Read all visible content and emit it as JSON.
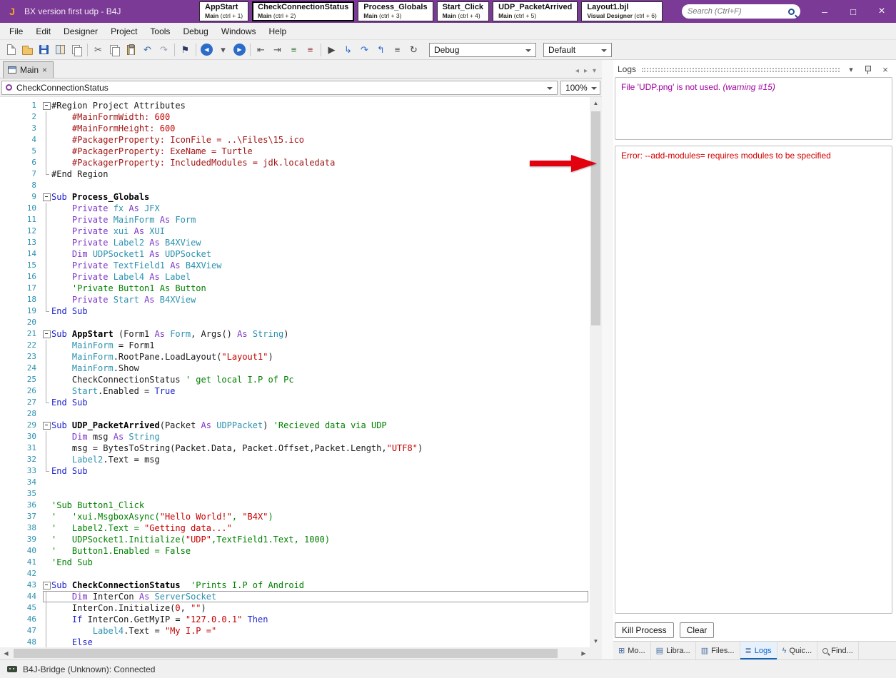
{
  "colors": {
    "titlebar": "#7A3A95",
    "warning_text": "#A000A0",
    "error_text": "#D40000",
    "line_number": "#2B91AF",
    "keyword": "#2025CC",
    "declaration": "#7C36C8",
    "type": "#2B91AF",
    "comment": "#008000",
    "string": "#C80000",
    "arrow": "#E3000F"
  },
  "titlebar": {
    "title": "BX version first udp - B4J",
    "search_placeholder": "Search (Ctrl+F)",
    "quick_tabs": [
      {
        "title": "AppStart",
        "sub_strong": "Main",
        "sub_rest": "  (ctrl + 1)",
        "selected": false
      },
      {
        "title": "CheckConnectionStatus",
        "sub_strong": "Main",
        "sub_rest": "  (ctrl + 2)",
        "selected": true
      },
      {
        "title": "Process_Globals",
        "sub_strong": "Main",
        "sub_rest": "  (ctrl + 3)",
        "selected": false
      },
      {
        "title": "Start_Click",
        "sub_strong": "Main",
        "sub_rest": "  (ctrl + 4)",
        "selected": false
      },
      {
        "title": "UDP_PacketArrived",
        "sub_strong": "Main",
        "sub_rest": "  (ctrl + 5)",
        "selected": false
      },
      {
        "title": "Layout1.bjl",
        "sub_strong": "Visual Designer",
        "sub_rest": "  (ctrl + 6)",
        "selected": false
      }
    ]
  },
  "menubar": {
    "items": [
      "File",
      "Edit",
      "Designer",
      "Project",
      "Tools",
      "Debug",
      "Windows",
      "Help"
    ]
  },
  "toolbar": {
    "debug_mode": "Debug",
    "build_configuration": "Default",
    "icons": [
      {
        "name": "new-icon",
        "kind": "page"
      },
      {
        "name": "open-icon",
        "kind": "folder"
      },
      {
        "name": "save-icon",
        "kind": "floppy"
      },
      {
        "name": "modules-icon",
        "kind": "grid"
      },
      {
        "name": "export-icon",
        "kind": "pages"
      },
      {
        "name": "sep1",
        "kind": "sep"
      },
      {
        "name": "cut-icon",
        "kind": "glyph",
        "glyph": "✂",
        "color": "#555555"
      },
      {
        "name": "copy-icon",
        "kind": "pages"
      },
      {
        "name": "paste-icon",
        "kind": "clip"
      },
      {
        "name": "undo-icon",
        "kind": "glyph",
        "glyph": "↶",
        "color": "#3A6EA5"
      },
      {
        "name": "redo-icon",
        "kind": "glyph",
        "glyph": "↷",
        "color": "#9AA7B8"
      },
      {
        "name": "sep2",
        "kind": "sep"
      },
      {
        "name": "bookmark-icon",
        "kind": "glyph",
        "glyph": "⚑",
        "color": "#2B3A67"
      },
      {
        "name": "sep3",
        "kind": "sep"
      },
      {
        "name": "navigate-back-icon",
        "kind": "navback"
      },
      {
        "name": "back-history-icon",
        "kind": "glyph",
        "glyph": "▾",
        "color": "#555555"
      },
      {
        "name": "navigate-forward-icon",
        "kind": "navfwd"
      },
      {
        "name": "sep4",
        "kind": "sep"
      },
      {
        "name": "outdent-icon",
        "kind": "glyph",
        "glyph": "⇤",
        "color": "#555555"
      },
      {
        "name": "indent-icon",
        "kind": "glyph",
        "glyph": "⇥",
        "color": "#555555"
      },
      {
        "name": "comment-icon",
        "kind": "glyph",
        "glyph": "≡",
        "color": "#3F7F3F"
      },
      {
        "name": "uncomment-icon",
        "kind": "glyph",
        "glyph": "≡",
        "color": "#9A3F3F"
      },
      {
        "name": "sep5",
        "kind": "sep"
      },
      {
        "name": "run-icon",
        "kind": "glyph",
        "glyph": "▶",
        "color": "#444444"
      },
      {
        "name": "step-into-icon",
        "kind": "glyph",
        "glyph": "↳",
        "color": "#2F6FD0"
      },
      {
        "name": "step-over-icon",
        "kind": "glyph",
        "glyph": "↷",
        "color": "#2F6FD0"
      },
      {
        "name": "step-out-icon",
        "kind": "glyph",
        "glyph": "↰",
        "color": "#2F6FD0"
      },
      {
        "name": "pause-icon",
        "kind": "glyph",
        "glyph": "≡",
        "color": "#555555"
      },
      {
        "name": "restart-icon",
        "kind": "glyph",
        "glyph": "↻",
        "color": "#444444"
      }
    ]
  },
  "editor": {
    "tab_label": "Main",
    "current_sub": "CheckConnectionStatus",
    "zoom": "100%",
    "lines": [
      {
        "n": 1,
        "f": "s",
        "s": [
          [
            "#Region Project Attributes",
            "pln"
          ]
        ]
      },
      {
        "n": 2,
        "f": "m",
        "s": [
          [
            "    ",
            "pln"
          ],
          [
            "#MainFormWidth: ",
            "dir"
          ],
          [
            "600",
            "num"
          ]
        ]
      },
      {
        "n": 3,
        "f": "m",
        "s": [
          [
            "    ",
            "pln"
          ],
          [
            "#MainFormHeight: ",
            "dir"
          ],
          [
            "600",
            "num"
          ]
        ]
      },
      {
        "n": 4,
        "f": "m",
        "s": [
          [
            "    ",
            "pln"
          ],
          [
            "#PackagerProperty: ",
            "dir"
          ],
          [
            "IconFile = ..\\Files\\15.ico",
            "dir"
          ]
        ]
      },
      {
        "n": 5,
        "f": "m",
        "s": [
          [
            "    ",
            "pln"
          ],
          [
            "#PackagerProperty: ",
            "dir"
          ],
          [
            "ExeName = Turtle",
            "dir"
          ]
        ]
      },
      {
        "n": 6,
        "f": "m",
        "s": [
          [
            "    ",
            "pln"
          ],
          [
            "#PackagerProperty: ",
            "dir"
          ],
          [
            "IncludedModules = jdk.localedata",
            "dir"
          ]
        ]
      },
      {
        "n": 7,
        "f": "e",
        "s": [
          [
            "#End Region",
            "pln"
          ]
        ]
      },
      {
        "n": 8,
        "f": "",
        "s": []
      },
      {
        "n": 9,
        "f": "s",
        "s": [
          [
            "Sub ",
            "kw"
          ],
          [
            "Process_Globals",
            "sub"
          ]
        ]
      },
      {
        "n": 10,
        "f": "m",
        "s": [
          [
            "    ",
            "pln"
          ],
          [
            "Private ",
            "decl"
          ],
          [
            "fx ",
            "var"
          ],
          [
            "As ",
            "decl"
          ],
          [
            "JFX",
            "type"
          ]
        ]
      },
      {
        "n": 11,
        "f": "m",
        "s": [
          [
            "    ",
            "pln"
          ],
          [
            "Private ",
            "decl"
          ],
          [
            "MainForm ",
            "var"
          ],
          [
            "As ",
            "decl"
          ],
          [
            "Form",
            "type"
          ]
        ]
      },
      {
        "n": 12,
        "f": "m",
        "s": [
          [
            "    ",
            "pln"
          ],
          [
            "Private ",
            "decl"
          ],
          [
            "xui ",
            "var"
          ],
          [
            "As ",
            "decl"
          ],
          [
            "XUI",
            "type"
          ]
        ]
      },
      {
        "n": 13,
        "f": "m",
        "s": [
          [
            "    ",
            "pln"
          ],
          [
            "Private ",
            "decl"
          ],
          [
            "Label2 ",
            "var"
          ],
          [
            "As ",
            "decl"
          ],
          [
            "B4XView",
            "type"
          ]
        ]
      },
      {
        "n": 14,
        "f": "m",
        "s": [
          [
            "    ",
            "pln"
          ],
          [
            "Dim ",
            "decl"
          ],
          [
            "UDPSocket1 ",
            "var"
          ],
          [
            "As ",
            "decl"
          ],
          [
            "UDPSocket",
            "type"
          ]
        ]
      },
      {
        "n": 15,
        "f": "m",
        "s": [
          [
            "    ",
            "pln"
          ],
          [
            "Private ",
            "decl"
          ],
          [
            "TextField1 ",
            "var"
          ],
          [
            "As ",
            "decl"
          ],
          [
            "B4XView",
            "type"
          ]
        ]
      },
      {
        "n": 16,
        "f": "m",
        "s": [
          [
            "    ",
            "pln"
          ],
          [
            "Private ",
            "decl"
          ],
          [
            "Label4 ",
            "var"
          ],
          [
            "As ",
            "decl"
          ],
          [
            "Label",
            "type"
          ]
        ]
      },
      {
        "n": 17,
        "f": "m",
        "s": [
          [
            "    ",
            "pln"
          ],
          [
            "'Private Button1 As Button",
            "com"
          ]
        ]
      },
      {
        "n": 18,
        "f": "m",
        "s": [
          [
            "    ",
            "pln"
          ],
          [
            "Private ",
            "decl"
          ],
          [
            "Start ",
            "var"
          ],
          [
            "As ",
            "decl"
          ],
          [
            "B4XView",
            "type"
          ]
        ]
      },
      {
        "n": 19,
        "f": "e",
        "s": [
          [
            "End Sub",
            "kw"
          ]
        ]
      },
      {
        "n": 20,
        "f": "",
        "s": []
      },
      {
        "n": 21,
        "f": "s",
        "s": [
          [
            "Sub ",
            "kw"
          ],
          [
            "AppStart ",
            "sub"
          ],
          [
            "(Form1 ",
            "pln"
          ],
          [
            "As ",
            "decl"
          ],
          [
            "Form",
            "type"
          ],
          [
            ", Args() ",
            "pln"
          ],
          [
            "As ",
            "decl"
          ],
          [
            "String",
            "type"
          ],
          [
            ")",
            "pln"
          ]
        ]
      },
      {
        "n": 22,
        "f": "m",
        "s": [
          [
            "    ",
            "pln"
          ],
          [
            "MainForm",
            "var"
          ],
          [
            " = Form1",
            "pln"
          ]
        ]
      },
      {
        "n": 23,
        "f": "m",
        "s": [
          [
            "    ",
            "pln"
          ],
          [
            "MainForm",
            "var"
          ],
          [
            ".RootPane.LoadLayout(",
            "pln"
          ],
          [
            "\"Layout1\"",
            "str"
          ],
          [
            ")",
            "pln"
          ]
        ]
      },
      {
        "n": 24,
        "f": "m",
        "s": [
          [
            "    ",
            "pln"
          ],
          [
            "MainForm",
            "var"
          ],
          [
            ".Show",
            "pln"
          ]
        ]
      },
      {
        "n": 25,
        "f": "m",
        "s": [
          [
            "    CheckConnectionStatus ",
            "pln"
          ],
          [
            "' get local I.P of Pc",
            "com"
          ]
        ]
      },
      {
        "n": 26,
        "f": "m",
        "s": [
          [
            "    ",
            "pln"
          ],
          [
            "Start",
            "var"
          ],
          [
            ".Enabled = ",
            "pln"
          ],
          [
            "True",
            "kw"
          ]
        ]
      },
      {
        "n": 27,
        "f": "e",
        "s": [
          [
            "End Sub",
            "kw"
          ]
        ]
      },
      {
        "n": 28,
        "f": "",
        "s": []
      },
      {
        "n": 29,
        "f": "s",
        "s": [
          [
            "Sub ",
            "kw"
          ],
          [
            "UDP_PacketArrived",
            "sub"
          ],
          [
            "(Packet ",
            "pln"
          ],
          [
            "As ",
            "decl"
          ],
          [
            "UDPPacket",
            "type"
          ],
          [
            ") ",
            "pln"
          ],
          [
            "'Recieved data via UDP",
            "com"
          ]
        ]
      },
      {
        "n": 30,
        "f": "m",
        "s": [
          [
            "    ",
            "pln"
          ],
          [
            "Dim ",
            "decl"
          ],
          [
            "msg ",
            "pln"
          ],
          [
            "As ",
            "decl"
          ],
          [
            "String",
            "type"
          ]
        ]
      },
      {
        "n": 31,
        "f": "m",
        "s": [
          [
            "    msg = BytesToString(Packet.Data, Packet.Offset,Packet.Length,",
            "pln"
          ],
          [
            "\"UTF8\"",
            "str"
          ],
          [
            ")",
            "pln"
          ]
        ]
      },
      {
        "n": 32,
        "f": "m",
        "s": [
          [
            "    ",
            "pln"
          ],
          [
            "Label2",
            "var"
          ],
          [
            ".Text = msg",
            "pln"
          ]
        ]
      },
      {
        "n": 33,
        "f": "e",
        "s": [
          [
            "End Sub",
            "kw"
          ]
        ]
      },
      {
        "n": 34,
        "f": "",
        "s": []
      },
      {
        "n": 35,
        "f": "",
        "s": []
      },
      {
        "n": 36,
        "f": "",
        "s": [
          [
            "'Sub Button1_Click",
            "com"
          ]
        ]
      },
      {
        "n": 37,
        "f": "",
        "s": [
          [
            "'   'xui.MsgboxAsync(",
            "com"
          ],
          [
            "\"Hello World!\"",
            "str"
          ],
          [
            ", ",
            "com"
          ],
          [
            "\"B4X\"",
            "str"
          ],
          [
            ")",
            "com"
          ]
        ]
      },
      {
        "n": 38,
        "f": "",
        "s": [
          [
            "'   Label2.Text = ",
            "com"
          ],
          [
            "\"Getting data...\"",
            "str"
          ]
        ]
      },
      {
        "n": 39,
        "f": "",
        "s": [
          [
            "'   UDPSocket1.Initialize(",
            "com"
          ],
          [
            "\"UDP\"",
            "str"
          ],
          [
            ",TextField1.Text, 1000)",
            "com"
          ]
        ]
      },
      {
        "n": 40,
        "f": "",
        "s": [
          [
            "'   Button1.Enabled = False",
            "com"
          ]
        ]
      },
      {
        "n": 41,
        "f": "",
        "s": [
          [
            "'End Sub",
            "com"
          ]
        ]
      },
      {
        "n": 42,
        "f": "",
        "s": []
      },
      {
        "n": 43,
        "f": "s",
        "s": [
          [
            "Sub ",
            "kw"
          ],
          [
            "CheckConnectionStatus",
            "sub"
          ],
          [
            "  ",
            "pln"
          ],
          [
            "'Prints I.P of Android",
            "com"
          ]
        ]
      },
      {
        "n": 44,
        "f": "m",
        "cur": true,
        "s": [
          [
            "    ",
            "pln"
          ],
          [
            "Dim ",
            "decl"
          ],
          [
            "InterCon ",
            "pln"
          ],
          [
            "As ",
            "decl"
          ],
          [
            "ServerSocket",
            "type"
          ]
        ]
      },
      {
        "n": 45,
        "f": "m",
        "s": [
          [
            "    InterCon.Initialize(",
            "pln"
          ],
          [
            "0",
            "num"
          ],
          [
            ", ",
            "pln"
          ],
          [
            "\"\"",
            "str"
          ],
          [
            ")",
            "pln"
          ]
        ]
      },
      {
        "n": 46,
        "f": "m",
        "s": [
          [
            "    ",
            "pln"
          ],
          [
            "If",
            "kw"
          ],
          [
            " InterCon.GetMyIP = ",
            "pln"
          ],
          [
            "\"127.0.0.1\"",
            "str"
          ],
          [
            " ",
            "pln"
          ],
          [
            "Then",
            "kw"
          ]
        ]
      },
      {
        "n": 47,
        "f": "m",
        "s": [
          [
            "        ",
            "pln"
          ],
          [
            "Label4",
            "var"
          ],
          [
            ".Text = ",
            "pln"
          ],
          [
            "\"My I.P =\"",
            "str"
          ]
        ]
      },
      {
        "n": 48,
        "f": "m",
        "s": [
          [
            "    ",
            "pln"
          ],
          [
            "Else",
            "kw"
          ]
        ]
      }
    ]
  },
  "logs": {
    "title": "Logs",
    "entries": [
      {
        "level": "warning",
        "parts": [
          {
            "t": "File 'UDP.png' is not used. "
          },
          {
            "t": "(warning #15)",
            "italic": true
          }
        ]
      },
      {
        "level": "error",
        "parts": [
          {
            "t": "Error: --add-modules= requires modules to be specified"
          }
        ]
      }
    ],
    "kill_button": "Kill Process",
    "clear_button": "Clear",
    "tabs": [
      {
        "label": "Mo...",
        "icon": "modules",
        "selected": false
      },
      {
        "label": "Libra...",
        "icon": "libraries",
        "selected": false
      },
      {
        "label": "Files...",
        "icon": "files",
        "selected": false
      },
      {
        "label": "Logs",
        "icon": "logs",
        "selected": true
      },
      {
        "label": "Quic...",
        "icon": "quick",
        "selected": false
      },
      {
        "label": "Find...",
        "icon": "find",
        "selected": false
      }
    ]
  },
  "statusbar": {
    "text": "B4J-Bridge (Unknown): Connected"
  }
}
